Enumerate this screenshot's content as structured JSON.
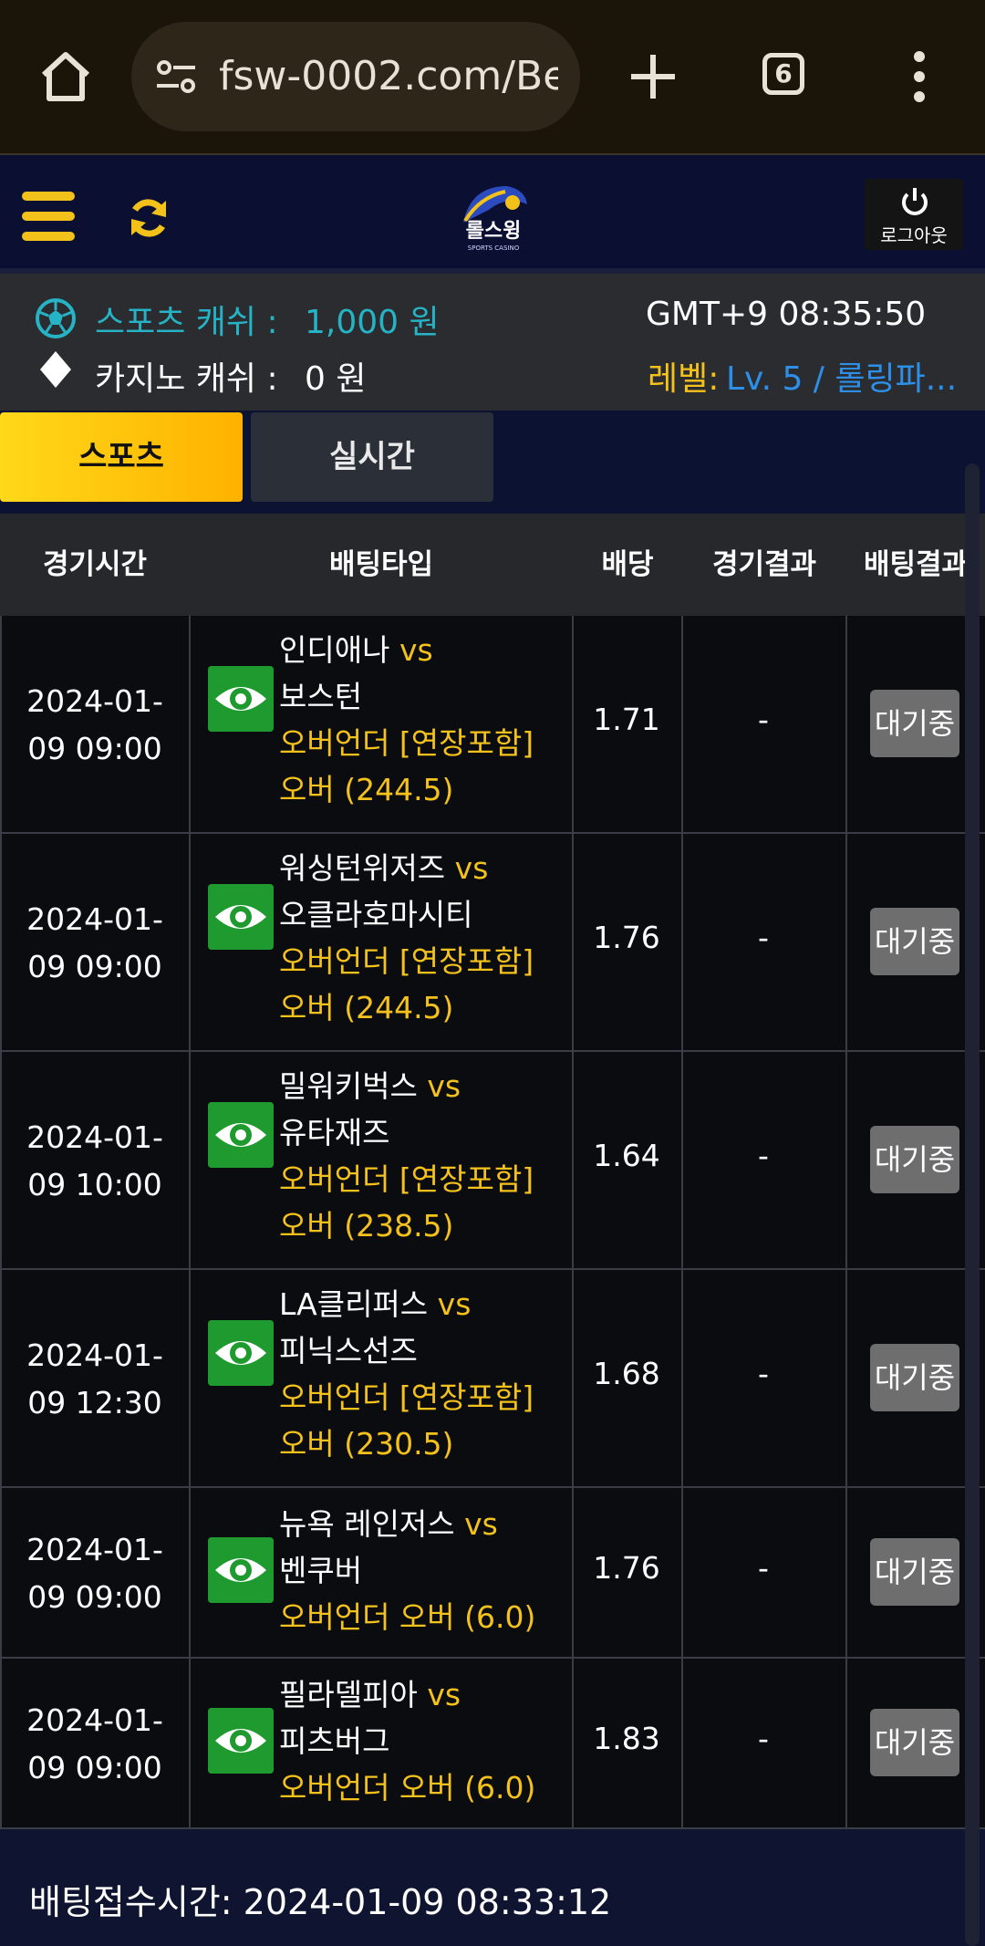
{
  "browser": {
    "url": "fsw-0002.com/Be",
    "tab_count": "6"
  },
  "header": {
    "logo_text": "롤스윙",
    "logo_sub": "SPORTS CASINO",
    "logout_label": "로그아웃"
  },
  "info": {
    "sports_cash_label": "스포츠 캐쉬 :",
    "sports_cash_value": "1,000 원",
    "casino_cash_label": "카지노 캐쉬 :",
    "casino_cash_value": "0 원",
    "clock": "GMT+9 08:35:50",
    "level_label": "레벨:",
    "level_value": "Lv. 5 / 롤링파..."
  },
  "tabs": {
    "sports": "스포츠",
    "live": "실시간"
  },
  "table": {
    "headers": [
      "경기시간",
      "배팅타입",
      "배당",
      "경기결과",
      "배팅결과"
    ],
    "rows": [
      {
        "date": "2024-01-",
        "time": "09 09:00",
        "home": "인디애나",
        "vs": "vs",
        "away": "보스턴",
        "type1": "오버언더 [연장포함]",
        "type2": "오버 (244.5)",
        "odds": "1.71",
        "result": "-",
        "status": "대기중"
      },
      {
        "date": "2024-01-",
        "time": "09 09:00",
        "home": "워싱턴위저즈",
        "vs": "vs",
        "away": "오클라호마시티",
        "type1": "오버언더 [연장포함]",
        "type2": "오버 (244.5)",
        "odds": "1.76",
        "result": "-",
        "status": "대기중"
      },
      {
        "date": "2024-01-",
        "time": "09 10:00",
        "home": "밀워키벅스",
        "vs": "vs",
        "away": "유타재즈",
        "type1": "오버언더 [연장포함]",
        "type2": "오버 (238.5)",
        "odds": "1.64",
        "result": "-",
        "status": "대기중"
      },
      {
        "date": "2024-01-",
        "time": "09 12:30",
        "home": "LA클리퍼스",
        "vs": "vs",
        "away": "피닉스선즈",
        "type1": "오버언더 [연장포함]",
        "type2": "오버 (230.5)",
        "odds": "1.68",
        "result": "-",
        "status": "대기중"
      },
      {
        "date": "2024-01-",
        "time": "09 09:00",
        "home": "뉴욕 레인저스",
        "vs": "vs",
        "away": "벤쿠버",
        "type1": "오버언더 오버 (6.0)",
        "type2": "",
        "odds": "1.76",
        "result": "-",
        "status": "대기중"
      },
      {
        "date": "2024-01-",
        "time": "09 09:00",
        "home": "필라델피아",
        "vs": "vs",
        "away": "피츠버그",
        "type1": "오버언더 오버 (6.0)",
        "type2": "",
        "odds": "1.83",
        "result": "-",
        "status": "대기중"
      }
    ]
  },
  "footer": {
    "bet_time": "배팅접수시간: 2024-01-09 08:33:12"
  },
  "colors": {
    "accent_yellow": "#f4c21b",
    "cash_teal": "#27b3c6",
    "level_blue": "#2e8fe8",
    "eye_green": "#1f9a2e",
    "status_gray": "#6e6e6e"
  }
}
